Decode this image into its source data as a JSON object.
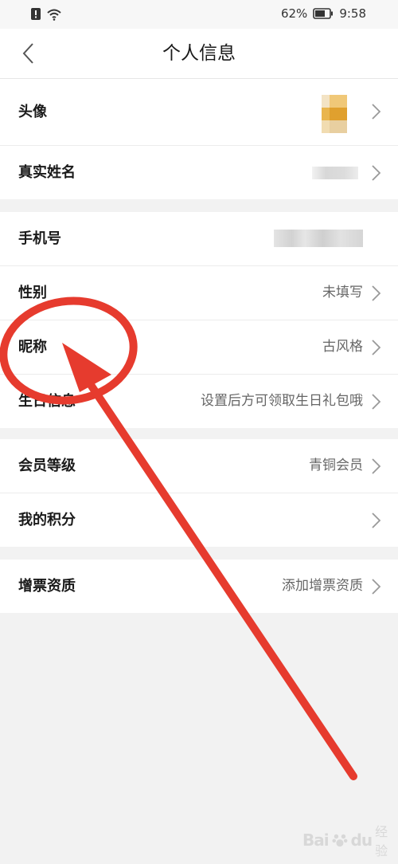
{
  "status_bar": {
    "battery_percent": "62%",
    "time": "9:58"
  },
  "header": {
    "title": "个人信息"
  },
  "section1": [
    {
      "label": "头像",
      "value": ""
    },
    {
      "label": "真实姓名",
      "value": ""
    }
  ],
  "section2": [
    {
      "label": "手机号",
      "value": ""
    },
    {
      "label": "性别",
      "value": "未填写"
    },
    {
      "label": "昵称",
      "value": "古风格"
    },
    {
      "label": "生日信息",
      "value": "设置后方可领取生日礼包哦"
    }
  ],
  "section3": [
    {
      "label": "会员等级",
      "value": "青铜会员"
    },
    {
      "label": "我的积分",
      "value": ""
    }
  ],
  "section4": [
    {
      "label": "增票资质",
      "value": "添加增票资质"
    }
  ],
  "watermark": {
    "brand": "Bai",
    "brand2": "du",
    "sub": "经验"
  },
  "colors": {
    "annotation_red": "#e63b2e",
    "background": "#f2f2f2"
  }
}
